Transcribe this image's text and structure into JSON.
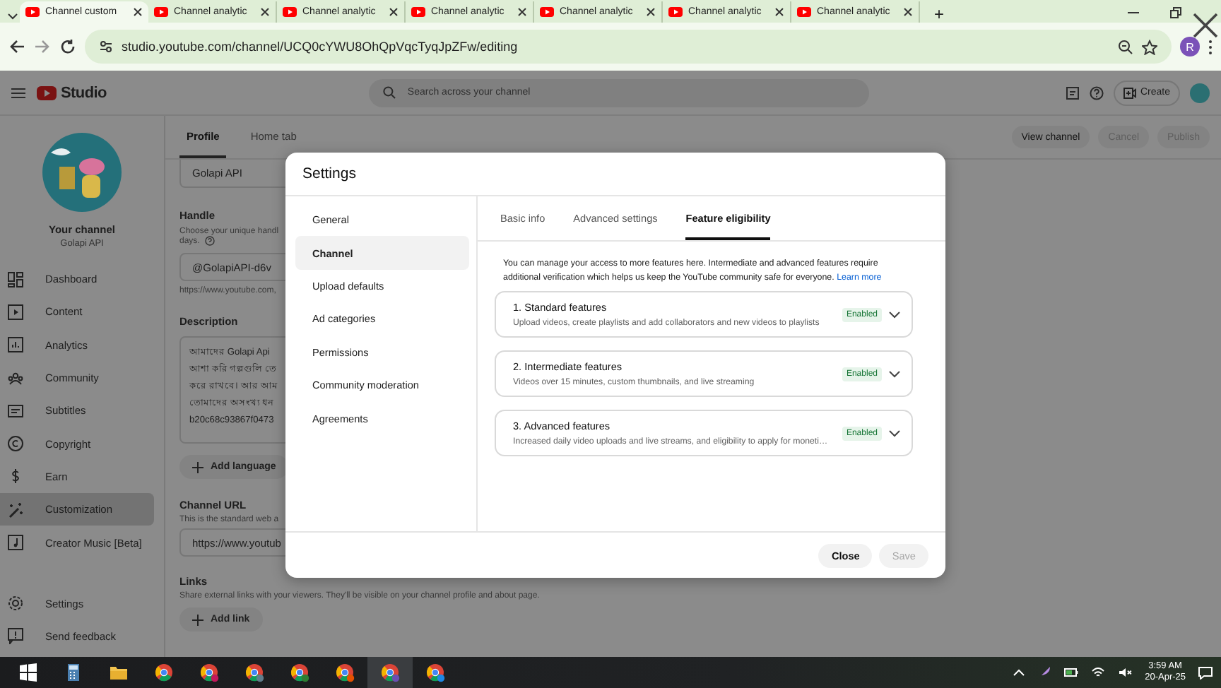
{
  "browser": {
    "tabs": [
      {
        "title": "Channel custom",
        "selected": true
      },
      {
        "title": "Channel analytic",
        "selected": false
      },
      {
        "title": "Channel analytic",
        "selected": false
      },
      {
        "title": "Channel analytic",
        "selected": false
      },
      {
        "title": "Channel analytic",
        "selected": false
      },
      {
        "title": "Channel analytic",
        "selected": false
      },
      {
        "title": "Channel analytic",
        "selected": false
      }
    ],
    "new_tab": "+",
    "address": "studio.youtube.com/channel/UCQ0cYWU8OhQpVqcTyqJpZFw/editing",
    "profile": "R"
  },
  "studio": {
    "logo": "Studio",
    "search": {
      "placeholder": "Search across your channel"
    },
    "create": "Create",
    "sidebar": {
      "channel_label": "Your channel",
      "channel_name": "Golapi API",
      "items": [
        {
          "label": "Dashboard",
          "selected": false
        },
        {
          "label": "Content",
          "selected": false
        },
        {
          "label": "Analytics",
          "selected": false
        },
        {
          "label": "Community",
          "selected": false
        },
        {
          "label": "Subtitles",
          "selected": false
        },
        {
          "label": "Copyright",
          "selected": false
        },
        {
          "label": "Earn",
          "selected": false
        },
        {
          "label": "Customization",
          "selected": true
        },
        {
          "label": "Creator Music [Beta]",
          "selected": false
        }
      ],
      "footer_items": [
        {
          "label": "Settings"
        },
        {
          "label": "Send feedback"
        }
      ]
    },
    "editor": {
      "tabs": [
        {
          "label": "Profile",
          "selected": true
        },
        {
          "label": "Home tab",
          "selected": false
        }
      ],
      "actions": [
        {
          "label": "View channel",
          "disabled": false
        },
        {
          "label": "Cancel",
          "disabled": true
        },
        {
          "label": "Publish",
          "disabled": true
        }
      ],
      "name_value": "Golapi API",
      "handle": {
        "label": "Handle",
        "hint": [
          "Choose your unique handl",
          "days."
        ],
        "value": "@GolapiAPI-d6v",
        "url": "https://www.youtube.com,"
      },
      "description": {
        "label": "Description",
        "lines": [
          "আমাদের Golapi Api",
          "আশা করি গল্পগুলি তে",
          "করে রাখবে। আর আম",
          "তোমাদের অসংখ্য ধন",
          "b20c68c93867f0473"
        ]
      },
      "add_language": "Add language",
      "channel_url": {
        "label": "Channel URL",
        "hint": "This is the standard web a",
        "value": "https://www.youtub"
      },
      "links": {
        "label": "Links",
        "hint": "Share external links with your viewers. They'll be visible on your channel profile and about page.",
        "button": "Add link"
      }
    }
  },
  "dialog": {
    "title": "Settings",
    "nav": [
      {
        "label": "General",
        "selected": false
      },
      {
        "label": "Channel",
        "selected": true
      },
      {
        "label": "Upload defaults",
        "selected": false
      },
      {
        "label": "Ad categories",
        "selected": false
      },
      {
        "label": "Permissions",
        "selected": false
      },
      {
        "label": "Community moderation",
        "selected": false
      },
      {
        "label": "Agreements",
        "selected": false
      }
    ],
    "tabs": [
      {
        "label": "Basic info",
        "selected": false
      },
      {
        "label": "Advanced settings",
        "selected": false
      },
      {
        "label": "Feature eligibility",
        "selected": true
      }
    ],
    "intro": "You can manage your access to more features here. Intermediate and advanced features require additional verification which helps us keep the YouTube community safe for everyone.",
    "learn_more": "Learn more",
    "features": [
      {
        "title": "1. Standard features",
        "description": "Upload videos, create playlists and add collaborators and new videos to playlists",
        "status": "Enabled",
        "enabled": true
      },
      {
        "title": "2. Intermediate features",
        "description": "Videos over 15 minutes, custom thumbnails, and live streaming",
        "status": "Enabled",
        "enabled": true
      },
      {
        "title": "3. Advanced features",
        "description": "Increased daily video uploads and live streams, and eligibility to apply for moneti…",
        "status": "Enabled",
        "enabled": true
      }
    ],
    "buttons": [
      {
        "label": "Close",
        "disabled": false
      },
      {
        "label": "Save",
        "disabled": true
      }
    ]
  },
  "taskbar": {
    "time": "3:59 AM",
    "date": "20-Apr-25"
  }
}
